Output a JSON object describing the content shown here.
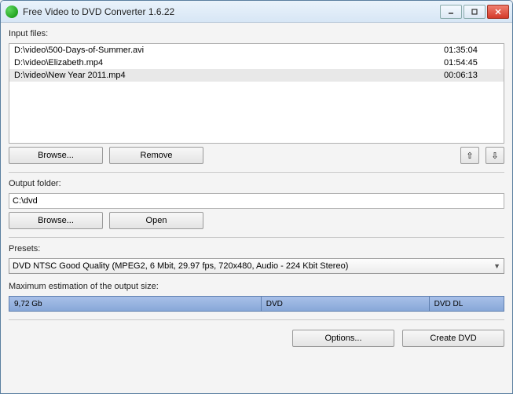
{
  "window": {
    "title": "Free Video to DVD Converter 1.6.22"
  },
  "input": {
    "label": "Input files:",
    "files": [
      {
        "path": "D:\\video\\500-Days-of-Summer.avi",
        "duration": "01:35:04"
      },
      {
        "path": "D:\\video\\Elizabeth.mp4",
        "duration": "01:54:45"
      },
      {
        "path": "D:\\video\\New Year 2011.mp4",
        "duration": "00:06:13"
      }
    ],
    "browse": "Browse...",
    "remove": "Remove",
    "up": "⇧",
    "down": "⇩"
  },
  "output": {
    "label": "Output folder:",
    "value": "C:\\dvd",
    "browse": "Browse...",
    "open": "Open"
  },
  "presets": {
    "label": "Presets:",
    "selected": "DVD NTSC Good Quality (MPEG2, 6 Mbit, 29.97 fps, 720x480, Audio - 224 Kbit Stereo)"
  },
  "size": {
    "label": "Maximum estimation of the output size:",
    "estimate": "9,72 Gb",
    "dvd": "DVD",
    "dvddl": "DVD DL"
  },
  "footer": {
    "options": "Options...",
    "create": "Create DVD"
  }
}
